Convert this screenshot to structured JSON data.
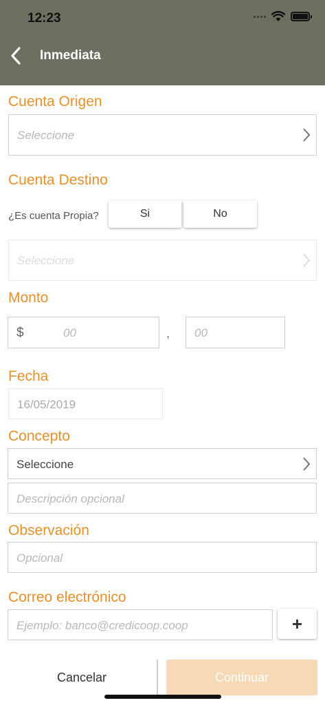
{
  "status_bar": {
    "time": "12:23"
  },
  "nav": {
    "title": "Inmediata"
  },
  "cuenta_origen": {
    "label": "Cuenta Origen",
    "placeholder": "Seleccione"
  },
  "cuenta_destino": {
    "label": "Cuenta Destino",
    "question": "¿Es cuenta Propia?",
    "yes_label": "Si",
    "no_label": "No",
    "placeholder": "Seleccione"
  },
  "monto": {
    "label": "Monto",
    "currency": "$",
    "integer_placeholder": "00",
    "separator": ",",
    "decimal_placeholder": "00"
  },
  "fecha": {
    "label": "Fecha",
    "value": "16/05/2019"
  },
  "concepto": {
    "label": "Concepto",
    "selected": "Seleccione",
    "description_placeholder": "Descripción opcional"
  },
  "observacion": {
    "label": "Observación",
    "placeholder": "Opcional"
  },
  "correo": {
    "label": "Correo electrónico",
    "placeholder": "Ejemplo: banco@credicoop.coop",
    "add_label": "+"
  },
  "actions": {
    "cancel_label": "Cancelar",
    "continue_label": "Continuar"
  },
  "colors": {
    "header": "#6e6e61",
    "accent": "#e8902a",
    "continue_disabled": "#f8d9b6"
  },
  "icons": [
    "back-chevron-icon",
    "chevron-right-icon",
    "wifi-icon",
    "battery-icon",
    "signal-icon"
  ]
}
